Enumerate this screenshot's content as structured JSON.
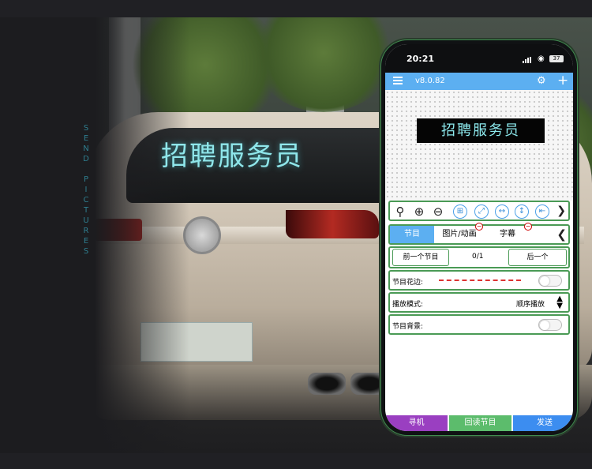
{
  "overlay": {
    "title": "招聘服务员",
    "vertical_text": "SEND PICTURES"
  },
  "phone": {
    "status": {
      "time": "20:21",
      "battery": "37"
    },
    "appbar": {
      "version": "v8.0.82"
    },
    "preview": {
      "led_text": "招聘服务员"
    },
    "toolbar": {
      "icons": [
        "magnifier-icon",
        "zoom-in-icon",
        "zoom-out-icon",
        "grid-icon",
        "fit-icon",
        "move-horizontal-icon",
        "move-vertical-icon",
        "align-left-icon",
        "next-icon"
      ]
    },
    "tabs": {
      "items": [
        "节目",
        "图片/动画",
        "字幕"
      ],
      "active": "节目"
    },
    "nav": {
      "prev_label": "前一个节目",
      "page": "0/1",
      "next_label": "后一个"
    },
    "settings": {
      "border_label": "节目花边:",
      "mode_label": "播放模式:",
      "mode_value": "顺序播放",
      "background_label": "节目背景:"
    },
    "bottom": {
      "search_label": "寻机",
      "readback_label": "回读节目",
      "send_label": "发送"
    }
  },
  "colors": {
    "accent": "#5caff1",
    "frame_green": "#4a9a55",
    "search_purple": "#9a3fc1",
    "readback_green": "#5cbc6c",
    "send_blue": "#3c8df0",
    "overlay_cyan": "#8fe6ea"
  }
}
